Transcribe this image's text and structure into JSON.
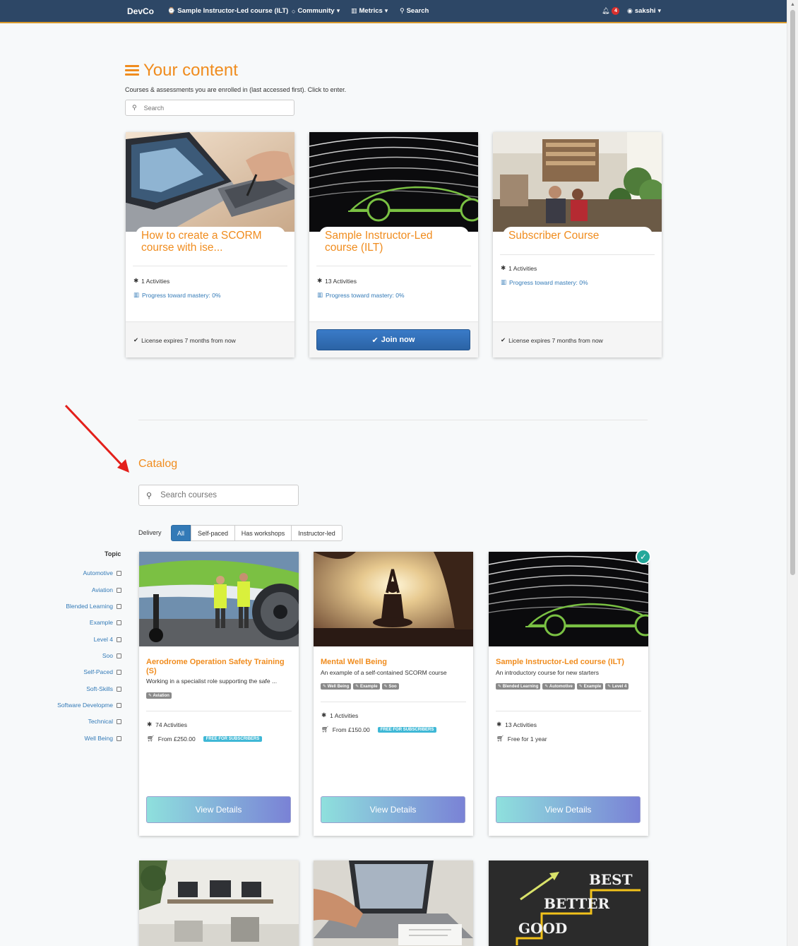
{
  "nav": {
    "brand": "DevCo",
    "course": "Sample Instructor-Led course (ILT)",
    "community": "Community",
    "metrics": "Metrics",
    "search": "Search",
    "notifications": "4",
    "user": "sakshi",
    "icons": [
      "dashboard-icon",
      "comment-icon",
      "bar-chart-icon",
      "search-icon",
      "bell-icon",
      "user-circle-icon"
    ]
  },
  "your_content": {
    "title": "Your content",
    "subtitle": "Courses & assessments you are enrolled in (last accessed first). Click to enter.",
    "search_placeholder": "Search",
    "cards": [
      {
        "title": "How to create a SCORM course with ise...",
        "activities": "1 Activities",
        "progress": "Progress toward mastery: 0%",
        "footer": "License expires 7 months from now"
      },
      {
        "title": "Sample Instructor-Led course (ILT)",
        "activities": "13 Activities",
        "progress": "Progress toward mastery: 0%",
        "button": "Join now"
      },
      {
        "title": "Subscriber Course",
        "activities": "1 Activities",
        "progress": "Progress toward mastery: 0%",
        "footer": "License expires 7 months from now"
      }
    ]
  },
  "catalog": {
    "title": "Catalog",
    "search_placeholder": "Search courses",
    "delivery_label": "Delivery",
    "delivery_options": [
      "All",
      "Self-paced",
      "Has workshops",
      "Instructor-led"
    ],
    "delivery_selected": "All",
    "topic_label": "Topic",
    "topics": [
      "Automotive",
      "Aviation",
      "Blended Learning",
      "Example",
      "Level 4",
      "Soo",
      "Self-Paced",
      "Soft-Skills",
      "Software Developme",
      "Technical",
      "Well Being"
    ],
    "cards": [
      {
        "title": "Aerodrome Operation Safety Training (S)",
        "desc": "Working in a specialist role supporting the safe ...",
        "tags": [
          "Aviation"
        ],
        "activities": "74 Activities",
        "price": "From £250.00",
        "badge": "FREE FOR SUBSCRIBERS",
        "button": "View Details"
      },
      {
        "title": "Mental Well Being",
        "desc": "An example of a self-contained SCORM course",
        "tags": [
          "Well Being",
          "Example",
          "Soo"
        ],
        "activities": "1 Activities",
        "price": "From £150.00",
        "badge": "FREE FOR SUBSCRIBERS",
        "button": "View Details"
      },
      {
        "title": "Sample Instructor-Led course (ILT)",
        "desc": "An introductory course for new starters",
        "tags": [
          "Blended Learning",
          "Automotive",
          "Example",
          "Level 4"
        ],
        "activities": "13 Activities",
        "price": "Free for 1 year",
        "button": "View Details",
        "enrolled": true
      }
    ],
    "bottom_card_texts": [
      "BEST",
      "BETTER",
      "GOOD"
    ]
  },
  "colors": {
    "accent": "#f08c1e",
    "nav": "#2d4766",
    "link": "#337ab7",
    "primary": "#337ab7"
  }
}
